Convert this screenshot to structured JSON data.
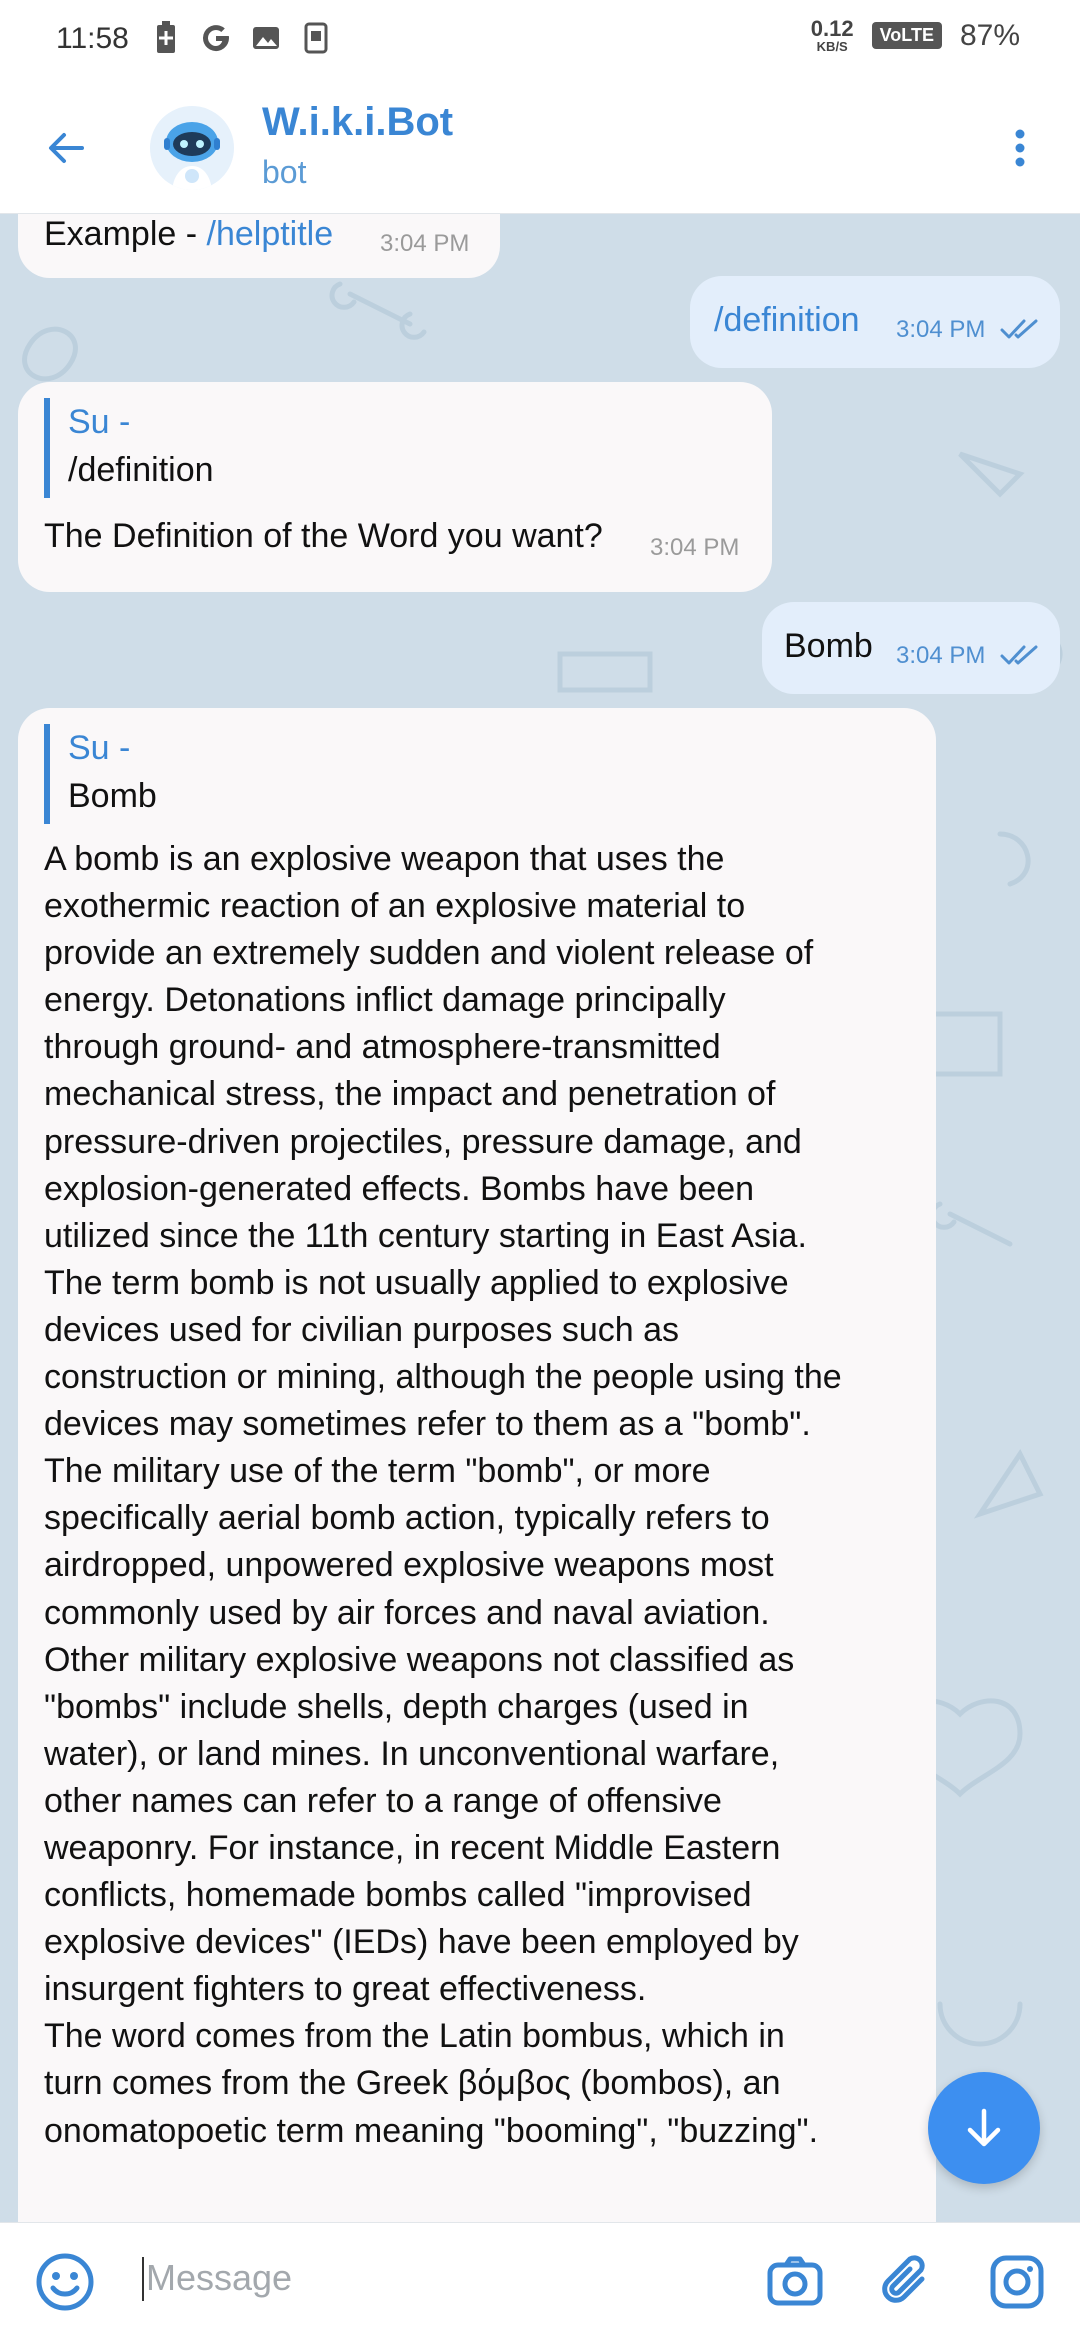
{
  "status_bar": {
    "time": "11:58",
    "net_speed_value": "0.12",
    "net_speed_unit": "KB/S",
    "volte": "VoLTE",
    "battery": "87%"
  },
  "header": {
    "name": "W.i.k.i.Bot",
    "subtitle": "bot"
  },
  "messages": {
    "m0": {
      "text_prefix": "Example - ",
      "link": "/helptitle",
      "time": "3:04 PM"
    },
    "m1": {
      "text": "/definition",
      "time": "3:04 PM"
    },
    "m2": {
      "reply_name": "Su -",
      "reply_text": "/definition",
      "text": "The Definition of the Word you want?",
      "time": "3:04 PM"
    },
    "m3": {
      "text": "Bomb",
      "time": "3:04 PM"
    },
    "m4": {
      "reply_name": "Su -",
      "reply_text": "Bomb",
      "lines": [
        "A bomb is an explosive weapon that uses the",
        "exothermic reaction of an explosive material to",
        "provide an extremely sudden and violent release of",
        "energy. Detonations inflict damage principally",
        "through ground- and atmosphere-transmitted",
        "mechanical stress, the impact and penetration of",
        "pressure-driven projectiles, pressure damage, and",
        "explosion-generated effects. Bombs have been",
        "utilized since the 11th century starting in East Asia.",
        "The term bomb is not usually applied to explosive",
        "devices used for civilian purposes such as",
        "construction or mining, although the people using the",
        "devices may sometimes refer to them as a \"bomb\".",
        "The military use of the term \"bomb\", or more",
        "specifically aerial bomb action, typically refers to",
        "airdropped, unpowered explosive weapons most",
        "commonly used by air forces and naval aviation.",
        "Other military explosive weapons not classified as",
        "\"bombs\" include shells, depth charges (used in",
        "water), or land mines. In unconventional warfare,",
        "other names can refer to a range of offensive",
        "weaponry. For instance, in recent Middle Eastern",
        "conflicts, homemade bombs called \"improvised",
        "explosive devices\" (IEDs) have been employed by",
        "insurgent fighters to great effectiveness.",
        "The word comes from the Latin bombus, which in",
        "turn comes from the Greek βόμβος (bombos), an",
        "onomatopoetic term meaning \"booming\", \"buzzing\"."
      ]
    }
  },
  "input": {
    "placeholder": "Message"
  },
  "icons": {
    "back": "arrow-left-icon",
    "more": "more-vertical-icon",
    "scroll_down": "arrow-down-icon",
    "emoji": "emoji-icon",
    "camera": "camera-icon",
    "attach": "paperclip-icon",
    "instagram": "instagram-icon"
  },
  "colors": {
    "accent": "#3a86d4",
    "chat_background": "#cfdde8",
    "incoming_bubble": "#faf8f9",
    "outgoing_bubble": "#e3eefb",
    "fab": "#3d8ff0"
  }
}
